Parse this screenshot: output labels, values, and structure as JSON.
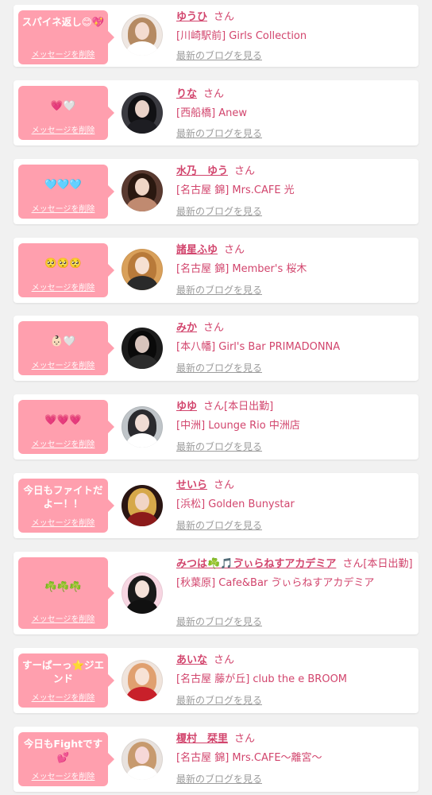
{
  "entries": [
    {
      "message": "スパイネ返し😊💖",
      "delete_label": "メッセージを削除",
      "name": "ゆうひ",
      "honorific": "さん",
      "status": "",
      "shop": "[川崎駅前] Girls Collection",
      "blog_label": "最新のブログを見る"
    },
    {
      "message": "💗🤍",
      "delete_label": "メッセージを削除",
      "name": "りな",
      "honorific": "さん",
      "status": "",
      "shop": "[西船橋] Anew",
      "blog_label": "最新のブログを見る"
    },
    {
      "message": "🩵🩵🩵",
      "delete_label": "メッセージを削除",
      "name": "水乃　ゆう",
      "honorific": "さん",
      "status": "",
      "shop": "[名古屋 錦] Mrs.CAFE 光",
      "blog_label": "最新のブログを見る"
    },
    {
      "message": "🥺🥺🥺",
      "delete_label": "メッセージを削除",
      "name": "諸星ふゆ",
      "honorific": "さん",
      "status": "",
      "shop": "[名古屋 錦] Member's 桜木",
      "blog_label": "最新のブログを見る"
    },
    {
      "message": "👶🏻🤍",
      "delete_label": "メッセージを削除",
      "name": "みか",
      "honorific": "さん",
      "status": "",
      "shop": "[本八幡] Girl's Bar PRIMADONNA",
      "blog_label": "最新のブログを見る"
    },
    {
      "message": "💗💗💗",
      "delete_label": "メッセージを削除",
      "name": "ゆゆ",
      "honorific": "さん",
      "status": "[本日出勤]",
      "shop": "[中洲] Lounge Rio 中洲店",
      "blog_label": "最新のブログを見る"
    },
    {
      "message": "今日もファイトだよー！！",
      "delete_label": "メッセージを削除",
      "name": "せいら",
      "honorific": "さん",
      "status": "",
      "shop": "[浜松] Golden Bunystar",
      "blog_label": "最新のブログを見る"
    },
    {
      "message": "☘️☘️☘️",
      "delete_label": "メッセージを削除",
      "name": "みつは☘️🎵ゔぃらねすアカデミア",
      "honorific": "さん",
      "status": "[本日出勤]",
      "shop": "[秋葉原] Cafe&Bar ゔぃらねすアカデミア",
      "blog_label": "最新のブログを見る"
    },
    {
      "message": "すーぱーっ⭐️ジエンド",
      "delete_label": "メッセージを削除",
      "name": "あいな",
      "honorific": "さん",
      "status": "",
      "shop": "[名古屋 藤が丘] club the e BROOM",
      "blog_label": "最新のブログを見る"
    },
    {
      "message": "今日もFightです💕",
      "delete_label": "メッセージを削除",
      "name": "榎村　栞里",
      "honorific": "さん",
      "status": "",
      "shop": "[名古屋 錦] Mrs.CAFE〜離宮〜",
      "blog_label": "最新のブログを見る"
    }
  ]
}
